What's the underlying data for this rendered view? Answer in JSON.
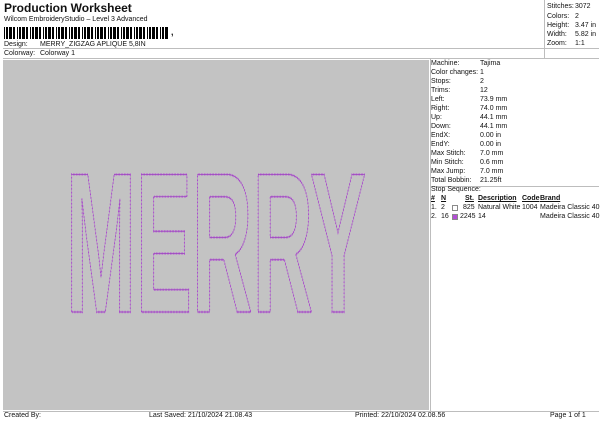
{
  "header": {
    "title": "Production Worksheet",
    "software": "Wilcom EmbroideryStudio – Level 3 Advanced",
    "barcode_tail": ","
  },
  "summary": [
    {
      "key": "Stitches:",
      "value": "3072"
    },
    {
      "key": "Colors:",
      "value": "2"
    },
    {
      "key": "Height:",
      "value": "3.47 in"
    },
    {
      "key": "Width:",
      "value": "5.82 in"
    },
    {
      "key": "Zoom:",
      "value": "1:1"
    }
  ],
  "design": {
    "design_label": "Design:",
    "design_value": "MERRY_ZIGZAG APLIQUE 5,8IN",
    "colorway_label": "Colorway:",
    "colorway_value": "Colorway 1"
  },
  "preview": {
    "text": "MERRY",
    "background_color": "#c3c3c3",
    "stitch_color": "#b44ed6",
    "outline_color": "#9b3ec0"
  },
  "machine_info": [
    {
      "key": "Machine:",
      "value": "Tajima"
    },
    {
      "key": "Color changes:",
      "value": "1"
    },
    {
      "key": "Stops:",
      "value": "2"
    },
    {
      "key": "Trims:",
      "value": "12"
    },
    {
      "key": "Left:",
      "value": "73.9 mm"
    },
    {
      "key": "Right:",
      "value": "74.0 mm"
    },
    {
      "key": "Up:",
      "value": "44.1 mm"
    },
    {
      "key": "Down:",
      "value": "44.1 mm"
    },
    {
      "key": "EndX:",
      "value": "0.00 in"
    },
    {
      "key": "EndY:",
      "value": "0.00 in"
    },
    {
      "key": "Max Stitch:",
      "value": "7.0 mm"
    },
    {
      "key": "Min Stitch:",
      "value": "0.6 mm"
    },
    {
      "key": "Max Jump:",
      "value": "7.0 mm"
    },
    {
      "key": "Total Bobbin:",
      "value": "21.25ft"
    }
  ],
  "stop_sequence": {
    "label": "Stop Sequence:",
    "headers": {
      "num": "#",
      "n": "N",
      "st": "St.",
      "description": "Description",
      "code": "Code",
      "brand": "Brand"
    },
    "rows": [
      {
        "num": "1.",
        "n": "2",
        "color": "#ffffff",
        "st": "825",
        "description": "Natural White",
        "code": "1004",
        "brand": "Madeira Classic 40"
      },
      {
        "num": "2.",
        "n": "16",
        "color": "#b44ed6",
        "st": "2245",
        "description": "14",
        "code": "",
        "brand": "Madeira Classic 40"
      }
    ]
  },
  "footer": {
    "created_by": "Created By:",
    "last_saved": "Last Saved: 21/10/2024 21.08.43",
    "printed": "Printed: 22/10/2024 02.08.56",
    "page": "Page 1 of 1"
  }
}
